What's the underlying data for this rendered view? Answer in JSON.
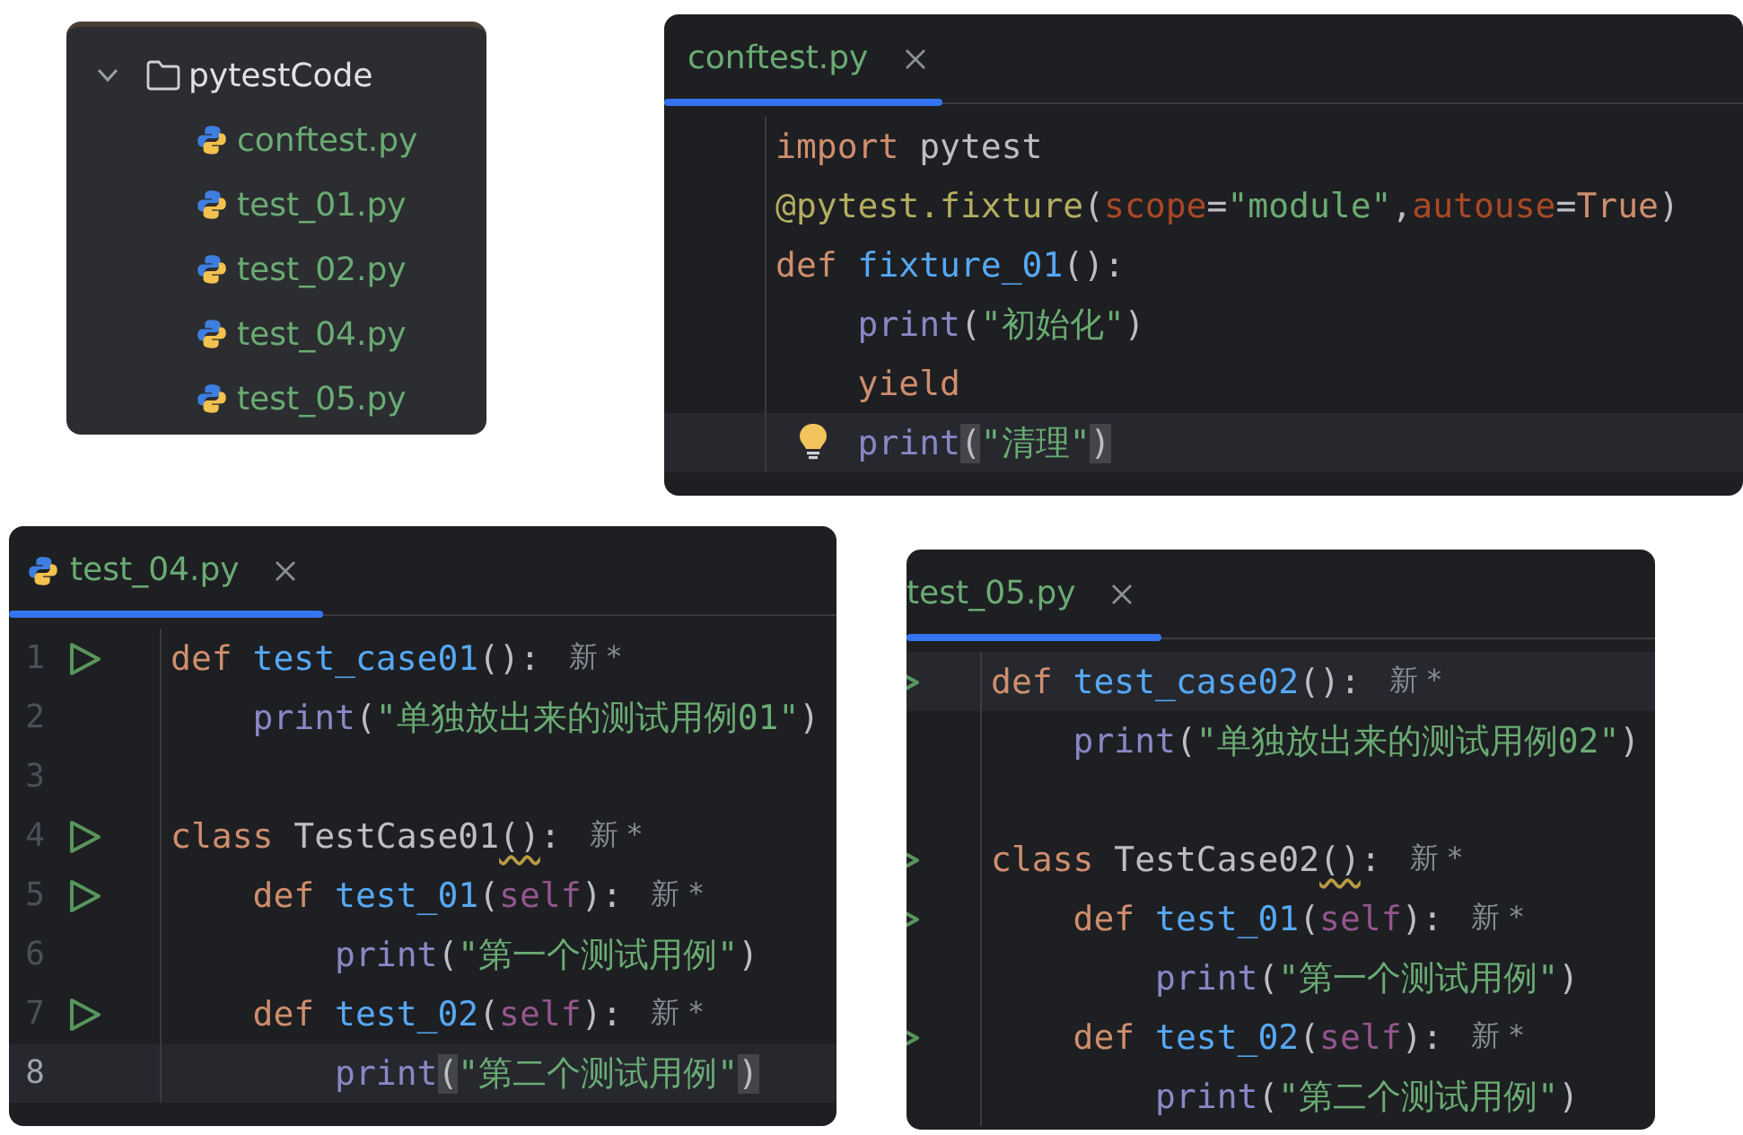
{
  "project_tree": {
    "folder": {
      "name": "pytestCode",
      "expanded": true,
      "children": [
        {
          "name": "conftest.py"
        },
        {
          "name": "test_01.py"
        },
        {
          "name": "test_02.py"
        },
        {
          "name": "test_04.py"
        },
        {
          "name": "test_05.py"
        }
      ]
    }
  },
  "editors": [
    {
      "tab": {
        "label": "conftest.py",
        "selected": true,
        "icon": false
      },
      "lines": [
        {
          "run": false,
          "current": false,
          "bulb": false,
          "tokens": [
            {
              "kind": "keyword",
              "text": "import"
            },
            {
              "kind": "plain",
              "text": " pytest"
            }
          ]
        },
        {
          "run": false,
          "current": false,
          "bulb": false,
          "tokens": [
            {
              "kind": "decorator",
              "text": "@pytest.fixture"
            },
            {
              "kind": "plain",
              "text": "("
            },
            {
              "kind": "kwarg",
              "text": "scope"
            },
            {
              "kind": "plain",
              "text": "="
            },
            {
              "kind": "string",
              "text": "\"module\""
            },
            {
              "kind": "plain",
              "text": ","
            },
            {
              "kind": "kwarg",
              "text": "autouse"
            },
            {
              "kind": "plain",
              "text": "="
            },
            {
              "kind": "keyword",
              "text": "True"
            },
            {
              "kind": "plain",
              "text": ")"
            }
          ]
        },
        {
          "run": false,
          "current": false,
          "bulb": false,
          "tokens": [
            {
              "kind": "keyword",
              "text": "def "
            },
            {
              "kind": "function",
              "text": "fixture_01"
            },
            {
              "kind": "plain",
              "text": "():"
            }
          ]
        },
        {
          "run": false,
          "current": false,
          "bulb": false,
          "tokens": [
            {
              "kind": "builtin",
              "text": "    print"
            },
            {
              "kind": "plain",
              "text": "("
            },
            {
              "kind": "string",
              "text": "\"初始化\""
            },
            {
              "kind": "plain",
              "text": ")"
            }
          ]
        },
        {
          "run": false,
          "current": false,
          "bulb": false,
          "tokens": [
            {
              "kind": "keyword",
              "text": "    yield"
            }
          ]
        },
        {
          "run": false,
          "current": true,
          "bulb": true,
          "tokens": [
            {
              "kind": "builtin",
              "text": "    print"
            },
            {
              "kind": "brace",
              "text": "("
            },
            {
              "kind": "string",
              "text": "\"清理\""
            },
            {
              "kind": "brace",
              "text": ")"
            }
          ]
        }
      ]
    },
    {
      "tab": {
        "label": "test_04.py",
        "selected": true,
        "icon": true
      },
      "lines": [
        {
          "number": "1",
          "run": true,
          "current": false,
          "bulb": false,
          "hint": "新 *",
          "tokens": [
            {
              "kind": "keyword",
              "text": "def "
            },
            {
              "kind": "function",
              "text": "test_case01"
            },
            {
              "kind": "plain",
              "text": "():"
            }
          ]
        },
        {
          "number": "2",
          "run": false,
          "current": false,
          "bulb": false,
          "tokens": [
            {
              "kind": "builtin",
              "text": "    print"
            },
            {
              "kind": "plain",
              "text": "("
            },
            {
              "kind": "string",
              "text": "\"单独放出来的测试用例01\""
            },
            {
              "kind": "plain",
              "text": ")"
            }
          ]
        },
        {
          "number": "3",
          "run": false,
          "current": false,
          "bulb": false
        },
        {
          "number": "4",
          "run": true,
          "current": false,
          "bulb": false,
          "hint": "新 *",
          "tokens": [
            {
              "kind": "keyword",
              "text": "class "
            },
            {
              "kind": "plain",
              "text": "TestCase01"
            },
            {
              "kind": "warning",
              "text": "()"
            },
            {
              "kind": "plain",
              "text": ":"
            }
          ]
        },
        {
          "number": "5",
          "run": true,
          "current": false,
          "bulb": false,
          "hint": "新 *",
          "tokens": [
            {
              "kind": "keyword",
              "text": "    def "
            },
            {
              "kind": "function",
              "text": "test_01"
            },
            {
              "kind": "plain",
              "text": "("
            },
            {
              "kind": "self",
              "text": "self"
            },
            {
              "kind": "plain",
              "text": "):"
            }
          ]
        },
        {
          "number": "6",
          "run": false,
          "current": false,
          "bulb": false,
          "tokens": [
            {
              "kind": "builtin",
              "text": "        print"
            },
            {
              "kind": "plain",
              "text": "("
            },
            {
              "kind": "string",
              "text": "\"第一个测试用例\""
            },
            {
              "kind": "plain",
              "text": ")"
            }
          ]
        },
        {
          "number": "7",
          "run": true,
          "current": false,
          "bulb": false,
          "hint": "新 *",
          "tokens": [
            {
              "kind": "keyword",
              "text": "    def "
            },
            {
              "kind": "function",
              "text": "test_02"
            },
            {
              "kind": "plain",
              "text": "("
            },
            {
              "kind": "self",
              "text": "self"
            },
            {
              "kind": "plain",
              "text": "):"
            }
          ]
        },
        {
          "number": "8",
          "run": false,
          "current": true,
          "bulb": false,
          "tokens": [
            {
              "kind": "builtin",
              "text": "        print"
            },
            {
              "kind": "brace",
              "text": "("
            },
            {
              "kind": "string",
              "text": "\"第二个测试用例\""
            },
            {
              "kind": "brace",
              "text": ")"
            }
          ]
        }
      ]
    },
    {
      "tab": {
        "label": "test_05.py",
        "selected": true,
        "icon": false
      },
      "lines": [
        {
          "run": true,
          "current": true,
          "bulb": false,
          "hint": "新 *",
          "tokens": [
            {
              "kind": "keyword",
              "text": "def "
            },
            {
              "kind": "function",
              "text": "test_case02"
            },
            {
              "kind": "plain",
              "text": "():"
            }
          ]
        },
        {
          "run": false,
          "current": false,
          "bulb": false,
          "tokens": [
            {
              "kind": "builtin",
              "text": "    print"
            },
            {
              "kind": "plain",
              "text": "("
            },
            {
              "kind": "string",
              "text": "\"单独放出来的测试用例02\""
            },
            {
              "kind": "plain",
              "text": ")"
            }
          ]
        },
        {
          "run": false,
          "current": false,
          "bulb": false
        },
        {
          "run": true,
          "current": false,
          "bulb": false,
          "hint": "新 *",
          "tokens": [
            {
              "kind": "keyword",
              "text": "class "
            },
            {
              "kind": "plain",
              "text": "TestCase02"
            },
            {
              "kind": "warning",
              "text": "()"
            },
            {
              "kind": "plain",
              "text": ":"
            }
          ]
        },
        {
          "run": true,
          "current": false,
          "bulb": false,
          "hint": "新 *",
          "tokens": [
            {
              "kind": "keyword",
              "text": "    def "
            },
            {
              "kind": "function",
              "text": "test_01"
            },
            {
              "kind": "plain",
              "text": "("
            },
            {
              "kind": "self",
              "text": "self"
            },
            {
              "kind": "plain",
              "text": "):"
            }
          ]
        },
        {
          "run": false,
          "current": false,
          "bulb": false,
          "tokens": [
            {
              "kind": "builtin",
              "text": "        print"
            },
            {
              "kind": "plain",
              "text": "("
            },
            {
              "kind": "string",
              "text": "\"第一个测试用例\""
            },
            {
              "kind": "plain",
              "text": ")"
            }
          ]
        },
        {
          "run": true,
          "current": false,
          "bulb": false,
          "hint": "新 *",
          "tokens": [
            {
              "kind": "keyword",
              "text": "    def "
            },
            {
              "kind": "function",
              "text": "test_02"
            },
            {
              "kind": "plain",
              "text": "("
            },
            {
              "kind": "self",
              "text": "self"
            },
            {
              "kind": "plain",
              "text": "):"
            }
          ]
        },
        {
          "run": false,
          "current": false,
          "bulb": false,
          "tokens": [
            {
              "kind": "builtin",
              "text": "        print"
            },
            {
              "kind": "plain",
              "text": "("
            },
            {
              "kind": "string",
              "text": "\"第二个测试用例\""
            },
            {
              "kind": "plain",
              "text": ")"
            }
          ]
        }
      ]
    }
  ]
}
